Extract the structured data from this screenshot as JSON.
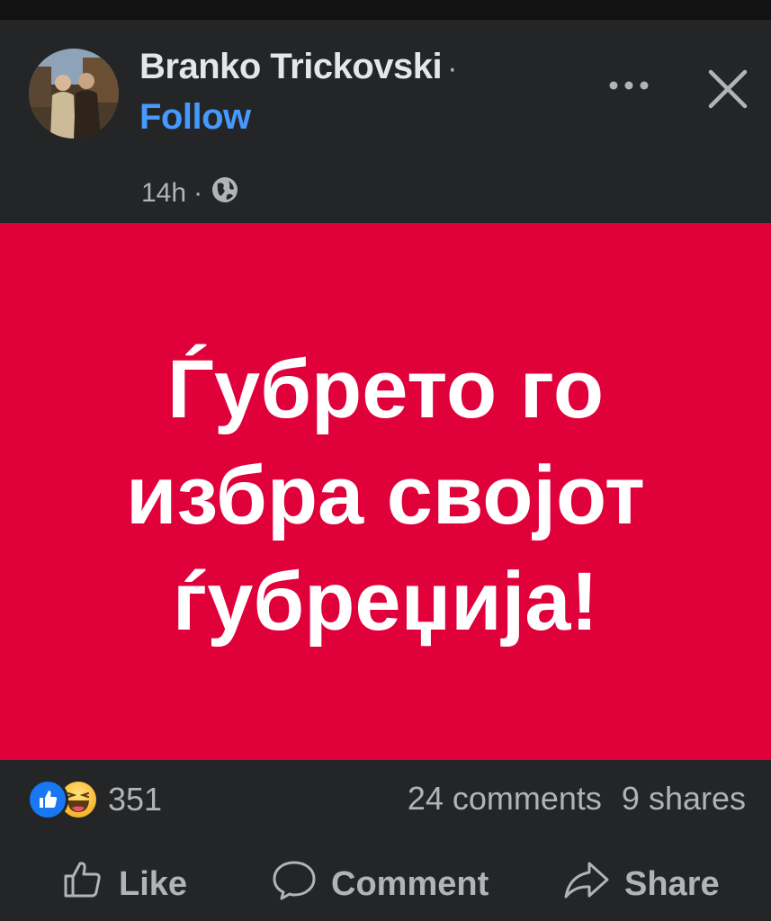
{
  "post": {
    "author": "Branko Trickovski",
    "separator": "·",
    "follow_label": "Follow",
    "time": "14h",
    "meta_separator": "·",
    "audience_icon": "globe-icon",
    "image": {
      "background": "#e0003a",
      "lines": [
        "Ѓубрето го",
        "избра својот",
        "ѓубреџија!"
      ]
    }
  },
  "stats": {
    "reaction_icons": [
      "like-reaction-icon",
      "haha-reaction-icon"
    ],
    "reaction_count": "351",
    "comments": "24 comments",
    "shares": "9 shares"
  },
  "actions": {
    "like": "Like",
    "comment": "Comment",
    "share": "Share"
  },
  "colors": {
    "background": "#242526",
    "follow": "#4599ff",
    "text_secondary": "#b0b3b8",
    "like_blue": "#1877f2"
  }
}
